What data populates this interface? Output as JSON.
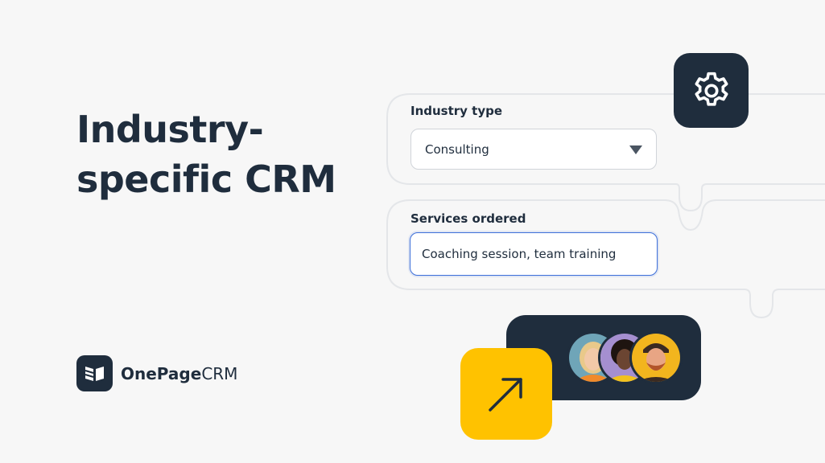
{
  "headline": {
    "line1": "Industry-",
    "line2": "specific CRM"
  },
  "brand": {
    "name_bold": "OnePage",
    "name_light": "CRM",
    "icon": "book-icon"
  },
  "form": {
    "industry_label": "Industry type",
    "industry_value": "Consulting",
    "services_label": "Services ordered",
    "services_value": "Coaching session, team training"
  },
  "icons": {
    "settings": "gear-icon",
    "caret": "caret-down-icon",
    "growth": "arrow-up-right-icon"
  },
  "colors": {
    "dark": "#1f2d3d",
    "accent_yellow": "#ffc200",
    "input_focus": "#3d6fd9",
    "background": "#f7f7f7"
  },
  "team": {
    "avatars": [
      "avatar-blonde-woman",
      "avatar-curly-hair-woman",
      "avatar-bearded-man"
    ]
  }
}
